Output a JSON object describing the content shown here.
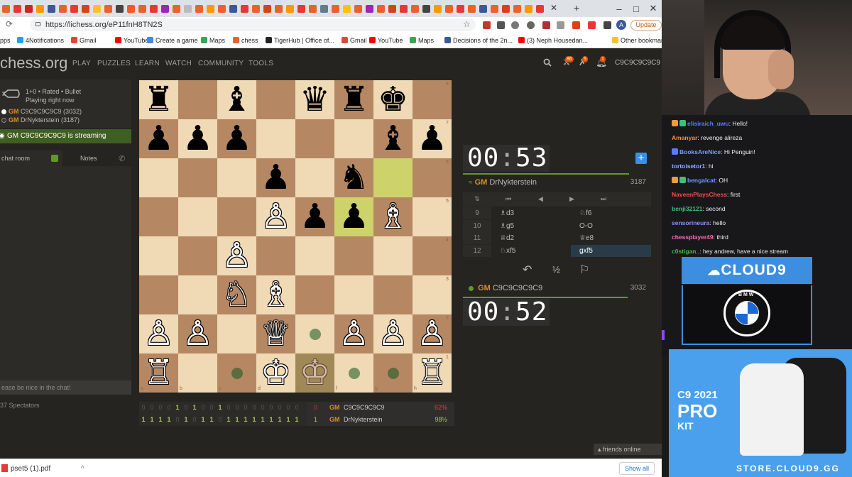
{
  "browser": {
    "url": "https://lichess.org/eP11fnH8TN2S",
    "update_label": "Update",
    "avatar_letter": "A",
    "bookmarks": [
      {
        "label": "pps"
      },
      {
        "label": "4Notifications"
      },
      {
        "label": "Gmail"
      },
      {
        "label": "YouTube"
      },
      {
        "label": "Create a game"
      },
      {
        "label": "Maps"
      },
      {
        "label": "chess"
      },
      {
        "label": "TigerHub | Office of..."
      },
      {
        "label": "Gmail"
      },
      {
        "label": "YouTube"
      },
      {
        "label": "Maps"
      },
      {
        "label": "Decisions of the 2n..."
      },
      {
        "label": "(3) Neph Housedan..."
      },
      {
        "label": "Other bookmark"
      }
    ],
    "download_file": "pset5 (1).pdf",
    "show_all": "Show all"
  },
  "lichess": {
    "logo": "chess.org",
    "nav": [
      "PLAY",
      "PUZZLES",
      "LEARN",
      "WATCH",
      "COMMUNITY",
      "TOOLS"
    ],
    "badges": {
      "challenges": "86",
      "alerts": "5",
      "notifications": "1"
    },
    "username": "C9C9C9C9C9",
    "game": {
      "type": "1+0 • Rated • Bullet",
      "status": "Playing right now",
      "white_player": "C9C9C9C9C9 (3032)",
      "black_player": "DrNykterstein (3187)",
      "title": "GM"
    },
    "streaming_text": "GM C9C9C9C9C9 is streaming",
    "chat_tab": "chat room",
    "notes_tab": "Notes",
    "chat_placeholder": "ease be nice in the chat!",
    "spectators": "37 Spectators",
    "clock_top": {
      "mm": "00",
      "ss": "53"
    },
    "clock_bottom": {
      "mm": "00",
      "ss": "52"
    },
    "opponent": {
      "title": "GM",
      "name": "DrNykterstein",
      "rating": "3187"
    },
    "me": {
      "title": "GM",
      "name": "C9C9C9C9C9",
      "rating": "3032"
    },
    "moves": [
      {
        "n": "9",
        "w": "♗d3",
        "b": "♘f6"
      },
      {
        "n": "10",
        "w": "♗g5",
        "b": "O-O"
      },
      {
        "n": "11",
        "w": "♕d2",
        "b": "♕e8"
      },
      {
        "n": "12",
        "w": "♘xf5",
        "b": "gxf5"
      }
    ],
    "controls": {
      "takeback": "↶",
      "draw": "½",
      "resign": "⚐"
    },
    "nav_buttons": {
      "flip": "⇅",
      "first": "⏮",
      "prev": "◀",
      "next": "▶",
      "last": "⏭"
    },
    "crosstable": {
      "row1": [
        "0",
        "0",
        "0",
        "0",
        "1",
        "0",
        "1",
        "0",
        "0",
        "1",
        "0",
        "0",
        "0",
        "0",
        "0",
        "0",
        "0",
        "0",
        "0"
      ],
      "row2": [
        "1",
        "1",
        "1",
        "1",
        "0",
        "1",
        "0",
        "1",
        "1",
        "0",
        "1",
        "1",
        "1",
        "1",
        "1",
        "1",
        "1",
        "1",
        "1"
      ],
      "p1": {
        "score": "0",
        "title": "GM",
        "name": "C9C9C9C9C9",
        "pct": "62%"
      },
      "p2": {
        "score": "1",
        "title": "GM",
        "name": "DrNykterstein",
        "pct": "98½"
      }
    },
    "friends_online": "friends online",
    "board": {
      "pieces": [
        {
          "sq": "a8",
          "p": "♜",
          "c": "b"
        },
        {
          "sq": "c8",
          "p": "♝",
          "c": "b"
        },
        {
          "sq": "e8",
          "p": "♛",
          "c": "b"
        },
        {
          "sq": "f8",
          "p": "♜",
          "c": "b"
        },
        {
          "sq": "g8",
          "p": "♚",
          "c": "b"
        },
        {
          "sq": "a7",
          "p": "♟",
          "c": "b"
        },
        {
          "sq": "b7",
          "p": "♟",
          "c": "b"
        },
        {
          "sq": "c7",
          "p": "♟",
          "c": "b"
        },
        {
          "sq": "g7",
          "p": "♝",
          "c": "b"
        },
        {
          "sq": "h7",
          "p": "♟",
          "c": "b"
        },
        {
          "sq": "d6",
          "p": "♟",
          "c": "b"
        },
        {
          "sq": "f6",
          "p": "♞",
          "c": "b"
        },
        {
          "sq": "d5",
          "p": "♙",
          "c": "w"
        },
        {
          "sq": "e5",
          "p": "♟",
          "c": "b"
        },
        {
          "sq": "f5",
          "p": "♟",
          "c": "b"
        },
        {
          "sq": "g5",
          "p": "♗",
          "c": "w"
        },
        {
          "sq": "c4",
          "p": "♙",
          "c": "w"
        },
        {
          "sq": "c3",
          "p": "♘",
          "c": "w"
        },
        {
          "sq": "d3",
          "p": "♗",
          "c": "w"
        },
        {
          "sq": "a2",
          "p": "♙",
          "c": "w"
        },
        {
          "sq": "b2",
          "p": "♙",
          "c": "w"
        },
        {
          "sq": "d2",
          "p": "♕",
          "c": "w"
        },
        {
          "sq": "f2",
          "p": "♙",
          "c": "w"
        },
        {
          "sq": "g2",
          "p": "♙",
          "c": "w"
        },
        {
          "sq": "h2",
          "p": "♙",
          "c": "w"
        },
        {
          "sq": "a1",
          "p": "♖",
          "c": "w"
        },
        {
          "sq": "d1",
          "p": "♔",
          "c": "w"
        },
        {
          "sq": "e1",
          "p": "♔",
          "c": "ghost"
        },
        {
          "sq": "h1",
          "p": "♖",
          "c": "w"
        }
      ],
      "lastmove": [
        "f5",
        "g6"
      ],
      "dots": [
        "e2",
        "c1",
        "f1",
        "g1"
      ],
      "ranks": [
        "8",
        "7",
        "6",
        "5",
        "4",
        "3",
        "2",
        "1"
      ],
      "files": [
        "a",
        "b",
        "c",
        "d",
        "e",
        "f",
        "g",
        "h"
      ]
    }
  },
  "stream": {
    "chat": [
      {
        "user": "elisiraich_uwu",
        "color": "#5b7bff",
        "text": ": Hello!",
        "badges": 2
      },
      {
        "user": "Amanyar",
        "color": "#ff8c3a",
        "text": ": revenge alireza",
        "badges": 0
      },
      {
        "user": "BooksAreNice",
        "color": "#7a9cff",
        "text": ": Hi Penguin!",
        "badges": 1
      },
      {
        "user": "tortoisetor1",
        "color": "#8fb0ff",
        "text": ": hi",
        "badges": 0
      },
      {
        "user": "bengalcat",
        "color": "#6a9bff",
        "text": ": OH",
        "badges": 2
      },
      {
        "user": "NaveenPlaysChess",
        "color": "#ff4a4a",
        "text": ": first",
        "badges": 0
      },
      {
        "user": "benji32121",
        "color": "#3fbf7f",
        "text": ": second",
        "badges": 0
      },
      {
        "user": "sensorineura",
        "color": "#8f8fff",
        "text": ": hello",
        "badges": 0
      },
      {
        "user": "chessplayer49",
        "color": "#ff69b4",
        "text": ": third",
        "badges": 0
      },
      {
        "user": "c0stigan_",
        "color": "#3fbf3f",
        "text": ": hey andrew, have a nice stream",
        "badges": 0
      }
    ],
    "sponsor": {
      "brand": "CLOUD9",
      "bmw": "B M W"
    },
    "kit": {
      "year": "C9 2021",
      "pro": "PRO",
      "kit": "KIT",
      "url": "STORE.CLOUD9.GG"
    }
  }
}
